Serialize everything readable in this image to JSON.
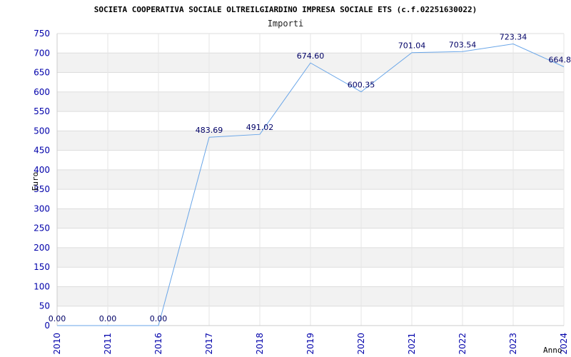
{
  "chart_data": {
    "type": "line",
    "title": "SOCIETA COOPERATIVA SOCIALE OLTREILGIARDINO IMPRESA SOCIALE ETS (c.f.02251630022)",
    "subtitle": "Importi",
    "ylabel": "Euro",
    "xlabel": "Anno",
    "categories": [
      "2010",
      "2011",
      "2016",
      "2017",
      "2018",
      "2019",
      "2020",
      "2021",
      "2022",
      "2023",
      "2024"
    ],
    "values": [
      0,
      0,
      0,
      483.69,
      491.02,
      674.6,
      600.35,
      701.04,
      703.54,
      723.34,
      664.8
    ],
    "labels": [
      "0.00",
      "0.00",
      "0.00",
      "483.69",
      "491.02",
      "674.60",
      "600.35",
      "701.04",
      "703.54",
      "723.34",
      "664.8"
    ],
    "ylim": [
      0,
      750
    ],
    "yticks": [
      "0",
      "50",
      "100",
      "150",
      "200",
      "250",
      "300",
      "350",
      "400",
      "450",
      "500",
      "550",
      "600",
      "650",
      "700",
      "750"
    ],
    "grid": true,
    "line_color": "#6aa6e8"
  }
}
